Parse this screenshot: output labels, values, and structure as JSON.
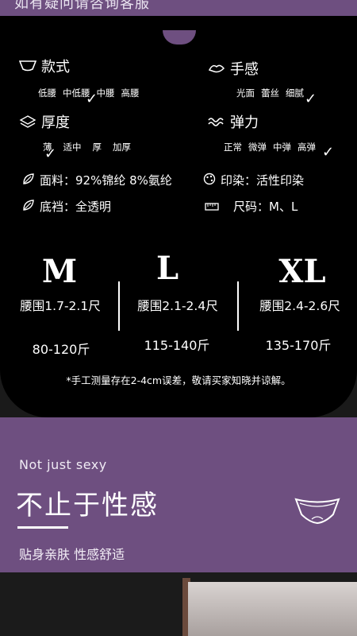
{
  "header": {
    "top_text": "如有疑问请咨询客服"
  },
  "specs": {
    "style": {
      "title": "款式",
      "icon": "briefs-icon",
      "options": [
        "低腰",
        "中低腰",
        "中腰",
        "高腰"
      ],
      "selected": "中低腰"
    },
    "feel": {
      "title": "手感",
      "icon": "hand-icon",
      "options": [
        "光面",
        "蕾丝",
        "细腻"
      ],
      "selected": "细腻"
    },
    "thickness": {
      "title": "厚度",
      "icon": "layers-icon",
      "options": [
        "薄",
        "适中",
        "厚",
        "加厚"
      ],
      "selected": "薄"
    },
    "elasticity": {
      "title": "弹力",
      "icon": "wave-icon",
      "options": [
        "正常",
        "微弹",
        "中弹",
        "高弹"
      ],
      "selected": "高弹"
    },
    "fabric": {
      "text": "面料：92%锦纶  8%氨纶",
      "icon": "leaf-icon"
    },
    "print": {
      "text": "印染：活性印染",
      "icon": "palette-icon"
    },
    "crotch": {
      "text": "底裆：全透明",
      "icon": "leaf-icon"
    },
    "size_code": {
      "text": "尺码：M、L",
      "icon": "ruler-icon"
    }
  },
  "sizes": [
    {
      "label": "M",
      "waist": "腰围1.7-2.1尺",
      "weight": "80-120斤"
    },
    {
      "label": "L",
      "waist": "腰围2.1-2.4尺",
      "weight": "115-140斤"
    },
    {
      "label": "XL",
      "waist": "腰围2.4-2.6尺",
      "weight": "135-170斤"
    }
  ],
  "note": "*手工测量存在2-4cm误差，敬请买家知晓并谅解。",
  "promo": {
    "subtitle_en": "Not just sexy",
    "title_cn": "不止于性感",
    "slogan": "贴身亲肤 性感舒适"
  },
  "colors": {
    "purple": "#6e4f80",
    "black": "#000000"
  }
}
